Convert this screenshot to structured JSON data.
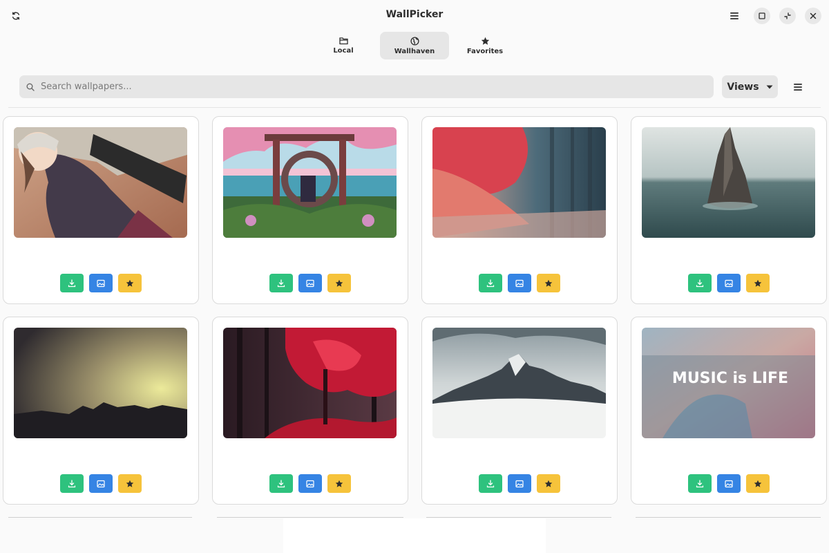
{
  "app": {
    "title": "WallPicker"
  },
  "tabs": [
    {
      "label": "Local",
      "icon": "folder-icon"
    },
    {
      "label": "Wallhaven",
      "icon": "globe-icon",
      "active": true
    },
    {
      "label": "Favorites",
      "icon": "star-icon"
    }
  ],
  "search": {
    "placeholder": "Search wallpapers..."
  },
  "views": {
    "label": "Views"
  },
  "colors": {
    "download": "#2ec27e",
    "set_wallpaper": "#3584e4",
    "favorite": "#f6c33b",
    "active_tab": "#e6e6e6"
  },
  "wallpapers": [
    {
      "subject": "anime girl with guitar case"
    },
    {
      "subject": "cherry blossom shrine gate"
    },
    {
      "subject": "red autumn forest"
    },
    {
      "subject": "sea stack rock"
    },
    {
      "subject": "mountain silhouette at dusk"
    },
    {
      "subject": "crimson forest"
    },
    {
      "subject": "snowy mountains"
    },
    {
      "subject": "music is life city"
    }
  ],
  "wallpaper_8_text": "MUSIC is LIFE"
}
